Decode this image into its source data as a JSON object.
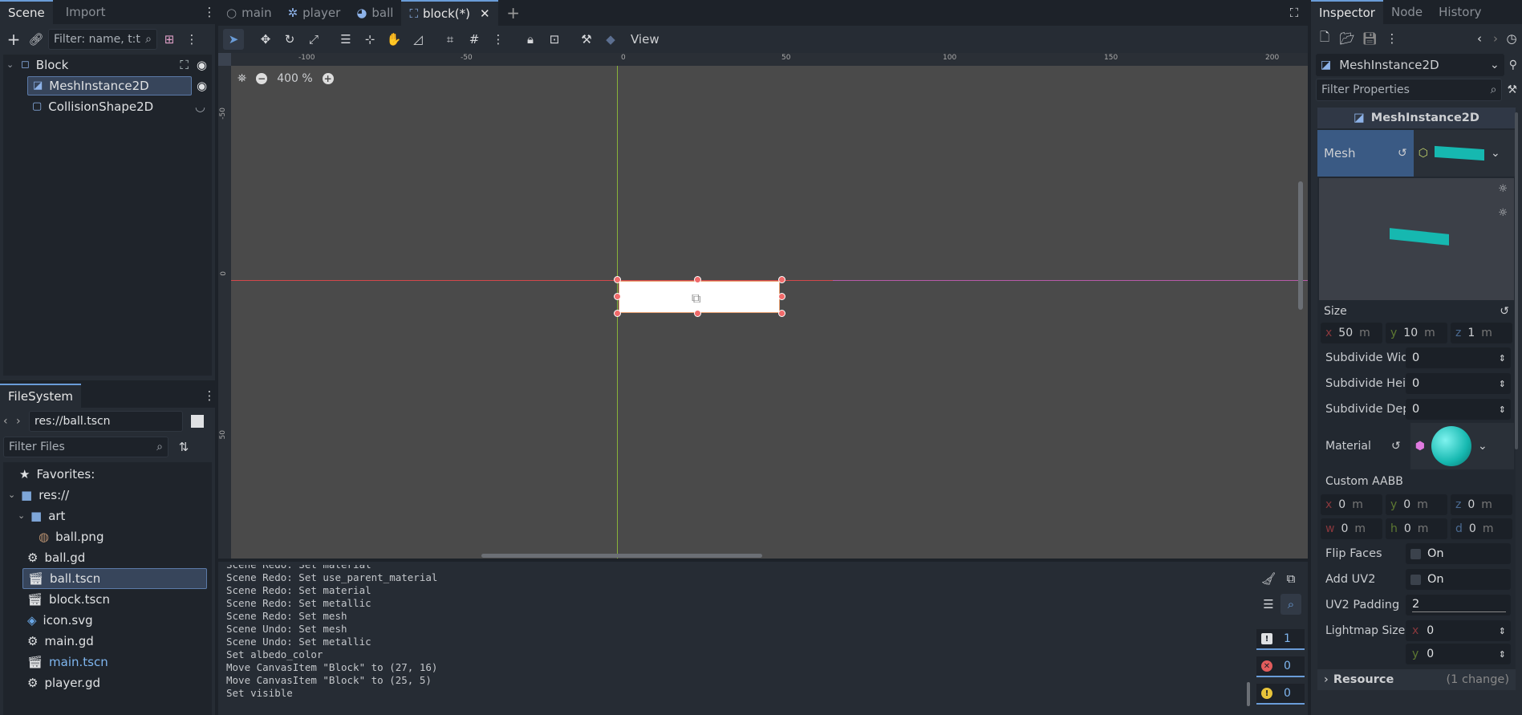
{
  "scene_dock": {
    "tabs": [
      "Scene",
      "Import"
    ],
    "filter_placeholder": "Filter: name, t:t",
    "nodes": [
      {
        "label": "Block"
      },
      {
        "label": "MeshInstance2D"
      },
      {
        "label": "CollisionShape2D"
      }
    ]
  },
  "editor_tabs": [
    "main",
    "player",
    "ball",
    "block(*)"
  ],
  "toolbar": {
    "view_label": "View"
  },
  "viewport": {
    "zoom": "400 %",
    "ruler_h": [
      "-100",
      "-50",
      "0",
      "50",
      "100",
      "150",
      "200"
    ],
    "ruler_v": [
      "-50",
      "0",
      "50"
    ]
  },
  "filesystem": {
    "title": "FileSystem",
    "path": "res://ball.tscn",
    "filter_placeholder": "Filter Files",
    "items": [
      {
        "label": "Favorites:"
      },
      {
        "label": "res://"
      },
      {
        "label": "art"
      },
      {
        "label": "ball.png"
      },
      {
        "label": "ball.gd"
      },
      {
        "label": "ball.tscn"
      },
      {
        "label": "block.tscn"
      },
      {
        "label": "icon.svg"
      },
      {
        "label": "main.gd"
      },
      {
        "label": "main.tscn"
      },
      {
        "label": "player.gd"
      }
    ]
  },
  "output": {
    "lines": [
      "Scene Redo: Set material",
      "Scene Redo: Set use_parent_material",
      "Scene Redo: Set material",
      "Scene Redo: Set metallic",
      "Scene Redo: Set mesh",
      "Scene Undo: Set mesh",
      "Scene Undo: Set metallic",
      "Set albedo_color",
      "Move CanvasItem \"Block\" to (27, 16)",
      "Move CanvasItem \"Block\" to (25, 5)",
      "Set visible"
    ],
    "counts": {
      "messages": "1",
      "errors": "0",
      "warnings": "0"
    }
  },
  "inspector": {
    "tabs": [
      "Inspector",
      "Node",
      "History"
    ],
    "object": "MeshInstance2D",
    "filter_placeholder": "Filter Properties",
    "section": "MeshInstance2D",
    "mesh_label": "Mesh",
    "size_label": "Size",
    "size": {
      "x_label": "x",
      "x": "50",
      "y_label": "y",
      "y": "10",
      "z_label": "z",
      "z": "1",
      "unit": "m"
    },
    "subdiv": [
      {
        "label": "Subdivide Widt",
        "value": "0"
      },
      {
        "label": "Subdivide Heig",
        "value": "0"
      },
      {
        "label": "Subdivide Dept",
        "value": "0"
      }
    ],
    "material_label": "Material",
    "aabb_label": "Custom AABB",
    "aabb": [
      {
        "k": "x",
        "v": "0"
      },
      {
        "k": "y",
        "v": "0"
      },
      {
        "k": "z",
        "v": "0"
      },
      {
        "k": "w",
        "v": "0"
      },
      {
        "k": "h",
        "v": "0"
      },
      {
        "k": "d",
        "v": "0"
      }
    ],
    "aabb_unit": "m",
    "flip_faces": {
      "label": "Flip Faces",
      "value": "On"
    },
    "add_uv2": {
      "label": "Add UV2",
      "value": "On"
    },
    "uv2_padding": {
      "label": "UV2 Padding",
      "value": "2"
    },
    "lightmap": {
      "label": "Lightmap Size",
      "x_label": "x",
      "x": "0",
      "y_label": "y",
      "y": "0"
    },
    "resource": {
      "label": "Resource",
      "changes": "(1 change)"
    }
  },
  "colors": {
    "accent": "#6a9cd8",
    "selection": "#37455b",
    "mesh_teal": "#16b8b0",
    "x_axis": "#d2474b",
    "y_axis": "#8ab33a"
  }
}
